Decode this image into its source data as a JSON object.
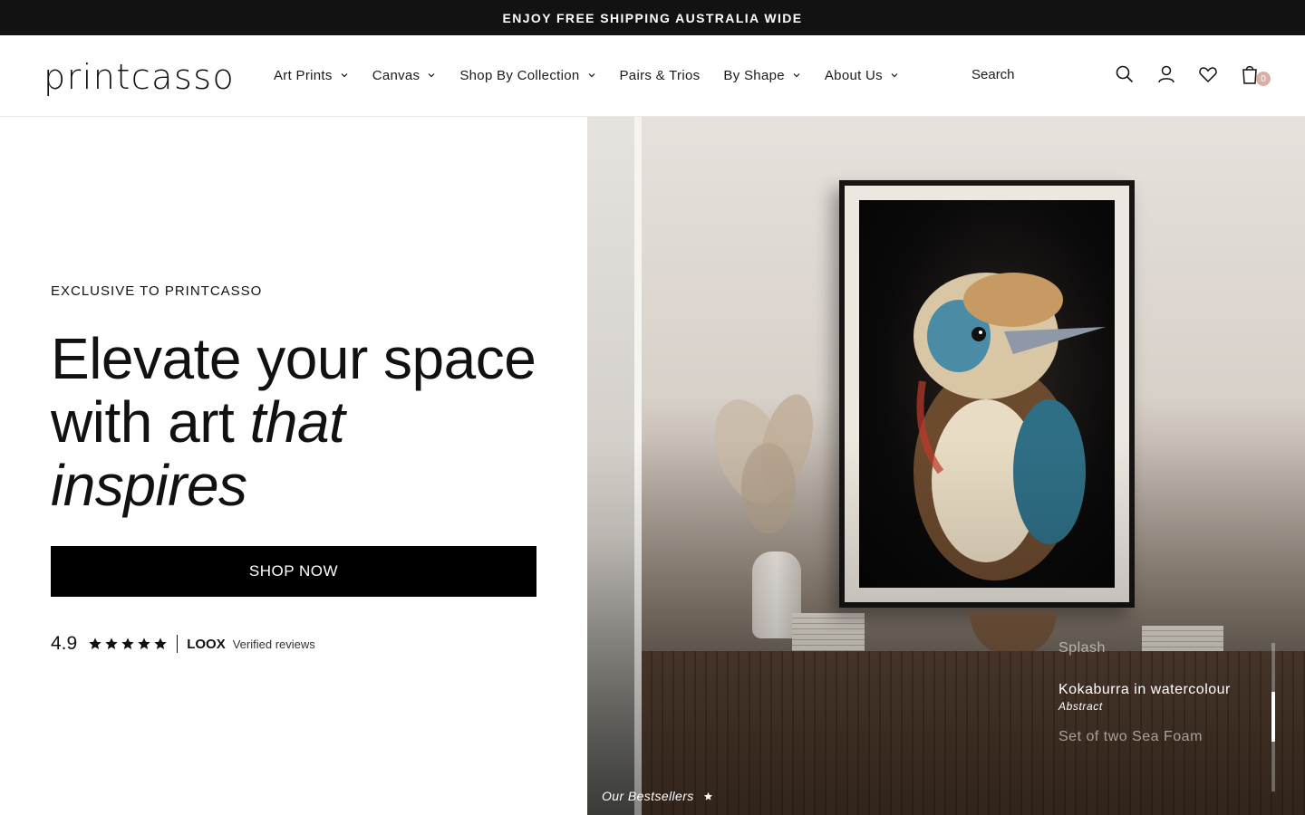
{
  "announcement": "ENJOY FREE SHIPPING AUSTRALIA WIDE",
  "brand": "printcasso",
  "nav": [
    {
      "label": "Art Prints",
      "has_dropdown": true
    },
    {
      "label": "Canvas",
      "has_dropdown": true
    },
    {
      "label": "Shop By Collection",
      "has_dropdown": true
    },
    {
      "label": "Pairs & Trios",
      "has_dropdown": false
    },
    {
      "label": "By Shape",
      "has_dropdown": true
    },
    {
      "label": "About Us",
      "has_dropdown": true
    }
  ],
  "search": {
    "label": "Search"
  },
  "header_icons": [
    "search-icon",
    "account-icon",
    "wishlist-icon",
    "cart-icon"
  ],
  "cart": {
    "count": "0"
  },
  "hero": {
    "eyebrow": "EXCLUSIVE TO PRINTCASSO",
    "headline_line1": "Elevate your space",
    "headline_line2": "with art ",
    "headline_italic_1": "that",
    "headline_italic_2": "inspires",
    "cta": "SHOP NOW",
    "rating": "4.9",
    "stars": 5,
    "review_brand": "LOOX",
    "review_text": "Verified reviews"
  },
  "slider": {
    "prev": "Splash",
    "current_title": "Kokaburra in watercolour",
    "current_category": "Abstract",
    "next": "Set of two Sea Foam",
    "footer": "Our Bestsellers"
  },
  "colors": {
    "announcement_bg": "#121212",
    "button_bg": "#000000",
    "cart_badge": "#d6b0a8"
  }
}
